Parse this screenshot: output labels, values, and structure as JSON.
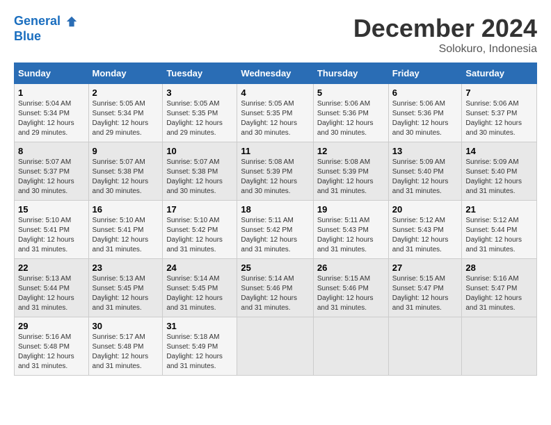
{
  "header": {
    "logo_line1": "General",
    "logo_line2": "Blue",
    "month_title": "December 2024",
    "location": "Solokuro, Indonesia"
  },
  "weekdays": [
    "Sunday",
    "Monday",
    "Tuesday",
    "Wednesday",
    "Thursday",
    "Friday",
    "Saturday"
  ],
  "weeks": [
    [
      {
        "day": "1",
        "rise": "5:04 AM",
        "set": "5:34 PM",
        "hours": "12 hours and 29 minutes"
      },
      {
        "day": "2",
        "rise": "5:05 AM",
        "set": "5:34 PM",
        "hours": "12 hours and 29 minutes"
      },
      {
        "day": "3",
        "rise": "5:05 AM",
        "set": "5:35 PM",
        "hours": "12 hours and 29 minutes"
      },
      {
        "day": "4",
        "rise": "5:05 AM",
        "set": "5:35 PM",
        "hours": "12 hours and 30 minutes"
      },
      {
        "day": "5",
        "rise": "5:06 AM",
        "set": "5:36 PM",
        "hours": "12 hours and 30 minutes"
      },
      {
        "day": "6",
        "rise": "5:06 AM",
        "set": "5:36 PM",
        "hours": "12 hours and 30 minutes"
      },
      {
        "day": "7",
        "rise": "5:06 AM",
        "set": "5:37 PM",
        "hours": "12 hours and 30 minutes"
      }
    ],
    [
      {
        "day": "8",
        "rise": "5:07 AM",
        "set": "5:37 PM",
        "hours": "12 hours and 30 minutes"
      },
      {
        "day": "9",
        "rise": "5:07 AM",
        "set": "5:38 PM",
        "hours": "12 hours and 30 minutes"
      },
      {
        "day": "10",
        "rise": "5:07 AM",
        "set": "5:38 PM",
        "hours": "12 hours and 30 minutes"
      },
      {
        "day": "11",
        "rise": "5:08 AM",
        "set": "5:39 PM",
        "hours": "12 hours and 30 minutes"
      },
      {
        "day": "12",
        "rise": "5:08 AM",
        "set": "5:39 PM",
        "hours": "12 hours and 31 minutes"
      },
      {
        "day": "13",
        "rise": "5:09 AM",
        "set": "5:40 PM",
        "hours": "12 hours and 31 minutes"
      },
      {
        "day": "14",
        "rise": "5:09 AM",
        "set": "5:40 PM",
        "hours": "12 hours and 31 minutes"
      }
    ],
    [
      {
        "day": "15",
        "rise": "5:10 AM",
        "set": "5:41 PM",
        "hours": "12 hours and 31 minutes"
      },
      {
        "day": "16",
        "rise": "5:10 AM",
        "set": "5:41 PM",
        "hours": "12 hours and 31 minutes"
      },
      {
        "day": "17",
        "rise": "5:10 AM",
        "set": "5:42 PM",
        "hours": "12 hours and 31 minutes"
      },
      {
        "day": "18",
        "rise": "5:11 AM",
        "set": "5:42 PM",
        "hours": "12 hours and 31 minutes"
      },
      {
        "day": "19",
        "rise": "5:11 AM",
        "set": "5:43 PM",
        "hours": "12 hours and 31 minutes"
      },
      {
        "day": "20",
        "rise": "5:12 AM",
        "set": "5:43 PM",
        "hours": "12 hours and 31 minutes"
      },
      {
        "day": "21",
        "rise": "5:12 AM",
        "set": "5:44 PM",
        "hours": "12 hours and 31 minutes"
      }
    ],
    [
      {
        "day": "22",
        "rise": "5:13 AM",
        "set": "5:44 PM",
        "hours": "12 hours and 31 minutes"
      },
      {
        "day": "23",
        "rise": "5:13 AM",
        "set": "5:45 PM",
        "hours": "12 hours and 31 minutes"
      },
      {
        "day": "24",
        "rise": "5:14 AM",
        "set": "5:45 PM",
        "hours": "12 hours and 31 minutes"
      },
      {
        "day": "25",
        "rise": "5:14 AM",
        "set": "5:46 PM",
        "hours": "12 hours and 31 minutes"
      },
      {
        "day": "26",
        "rise": "5:15 AM",
        "set": "5:46 PM",
        "hours": "12 hours and 31 minutes"
      },
      {
        "day": "27",
        "rise": "5:15 AM",
        "set": "5:47 PM",
        "hours": "12 hours and 31 minutes"
      },
      {
        "day": "28",
        "rise": "5:16 AM",
        "set": "5:47 PM",
        "hours": "12 hours and 31 minutes"
      }
    ],
    [
      {
        "day": "29",
        "rise": "5:16 AM",
        "set": "5:48 PM",
        "hours": "12 hours and 31 minutes"
      },
      {
        "day": "30",
        "rise": "5:17 AM",
        "set": "5:48 PM",
        "hours": "12 hours and 31 minutes"
      },
      {
        "day": "31",
        "rise": "5:18 AM",
        "set": "5:49 PM",
        "hours": "12 hours and 31 minutes"
      },
      null,
      null,
      null,
      null
    ]
  ]
}
